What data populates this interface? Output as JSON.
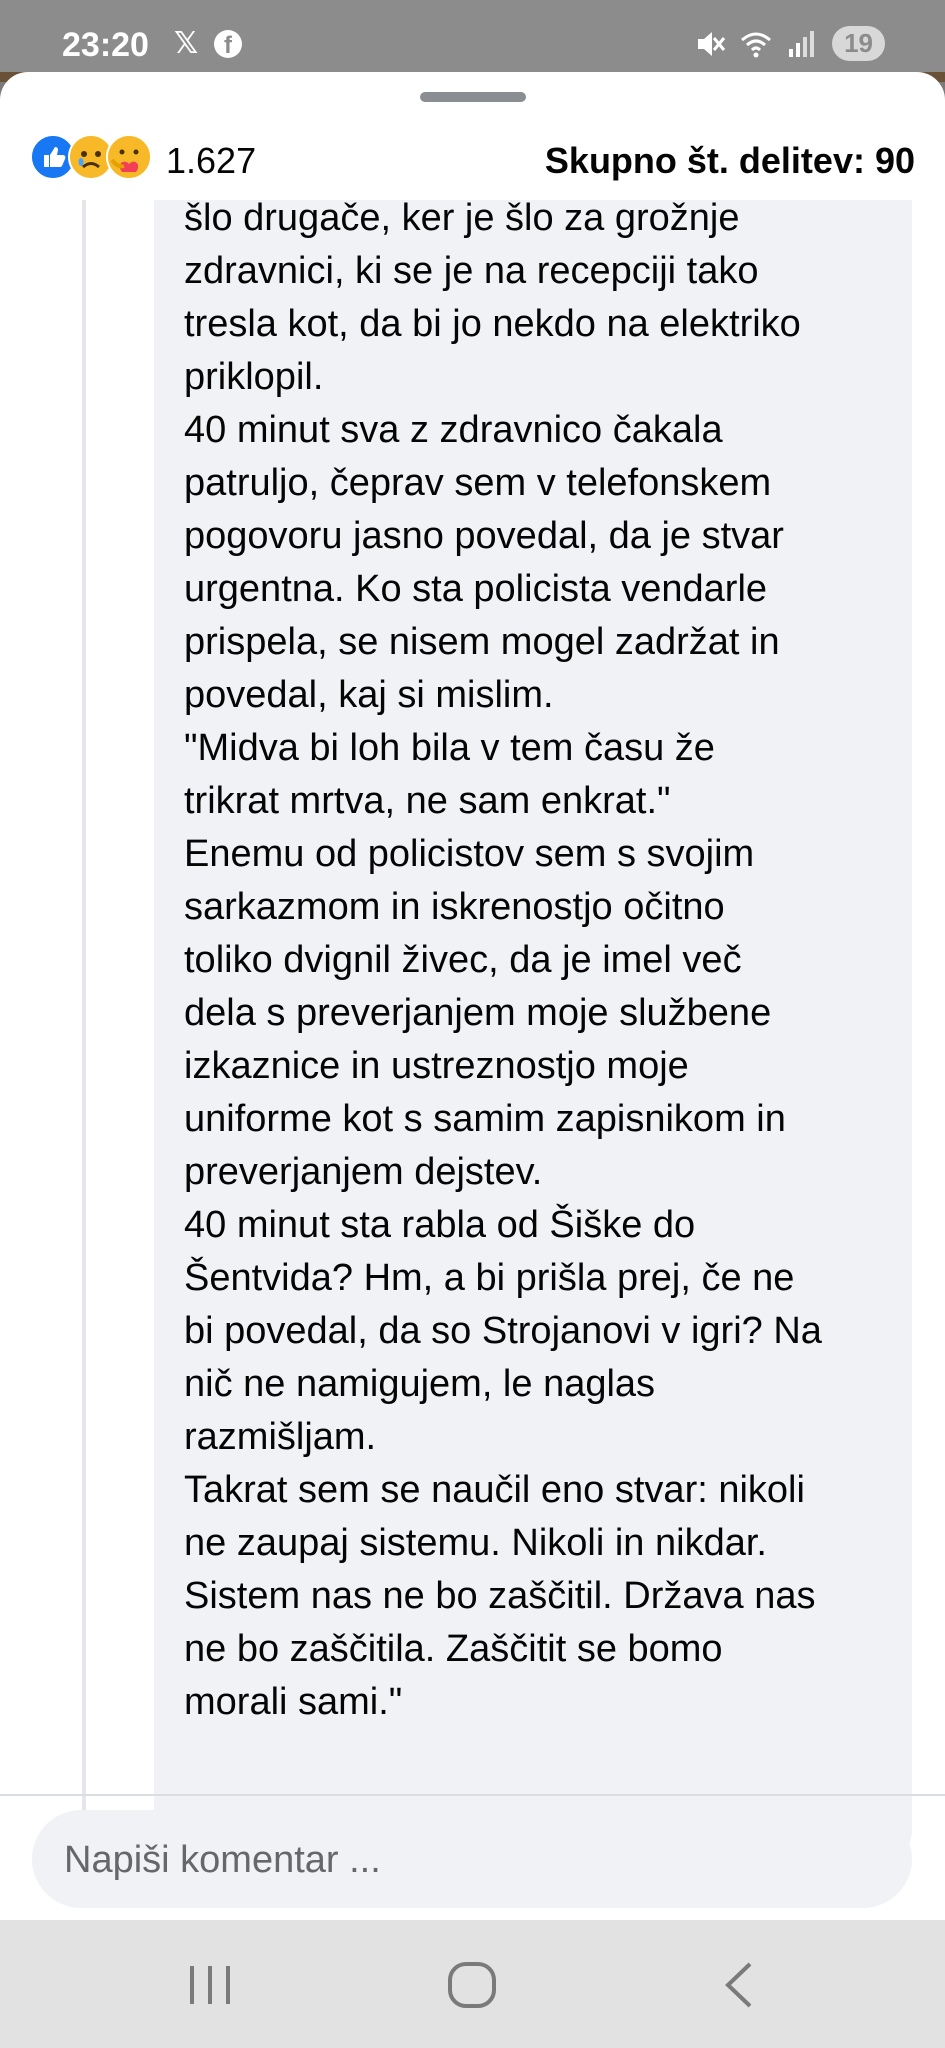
{
  "status_bar": {
    "time": "23:20",
    "x_icon": "x-logo-icon",
    "fb_icon": "facebook-logo-icon",
    "mute_icon": "mute-icon",
    "wifi_icon": "wifi-icon",
    "signal_icon": "signal-icon",
    "notification_count": "19"
  },
  "reactions": {
    "icons": [
      "like-reaction-icon",
      "sad-reaction-icon",
      "care-reaction-icon"
    ],
    "count": "1.627",
    "shares_label": "Skupno št. delitev: 90"
  },
  "comment": {
    "text": "šlo drugače, ker je šlo za grožnje\nzdravnici, ki se je na recepciji tako\ntresla kot, da bi jo nekdo na elektriko\npriklopil.\n40 minut sva z zdravnico čakala\npatruljo, čeprav sem v telefonskem\npogovoru jasno povedal, da je stvar\nurgentna. Ko sta policista vendarle\nprispela, se nisem mogel zadržat in\npovedal, kaj si mislim.\n\"Midva bi loh bila v tem času že\ntrikrat mrtva, ne sam enkrat.\"\nEnemu od policistov sem s svojim\nsarkazmom in iskrenostjo očitno\ntoliko dvignil živec, da je imel več\ndela s preverjanjem moje službene\nizkaznice in ustreznostjo moje\nuniforme kot s samim zapisnikom in\npreverjanjem dejstev.\n40 minut sta rabla od Šiške do\nŠentvida? Hm, a bi prišla prej, če ne\nbi povedal, da so Strojanovi v igri? Na\nnič ne namigujem, le naglas\nrazmišljam.\nTakrat sem se naučil eno stvar: nikoli\nne zaupaj sistemu. Nikoli in nikdar.\nSistem nas ne bo zaščitil. Država nas\nne bo zaščitila. Zaščitit se bomo\nmorali sami.\""
  },
  "composer": {
    "placeholder": "Napiši komentar ..."
  },
  "navigation": {
    "recent_icon": "recent-apps-icon",
    "home_icon": "home-icon",
    "back_icon": "back-icon"
  }
}
